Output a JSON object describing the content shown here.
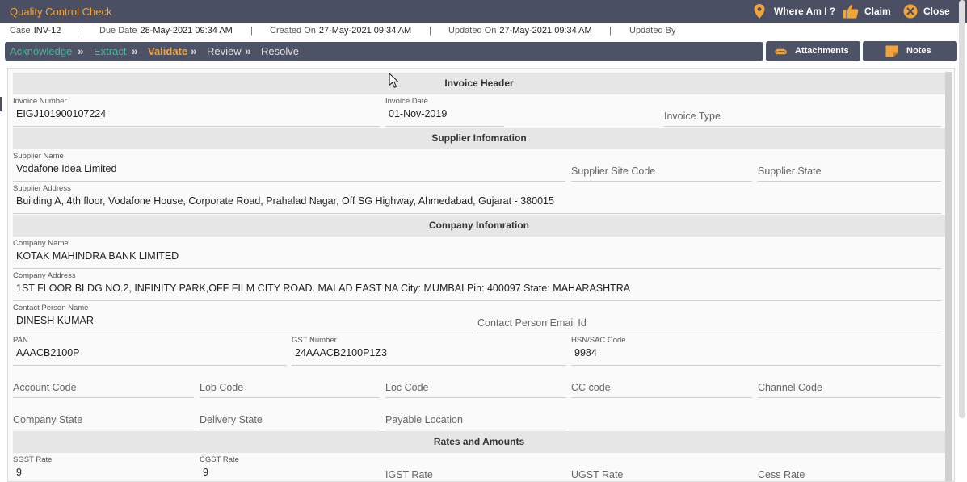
{
  "app": {
    "title": "Quality Control Check",
    "accent": "#f0a43a",
    "header_bg": "#4a4f63"
  },
  "actions": {
    "where": "Where Am I ?",
    "claim": "Claim",
    "close": "Close"
  },
  "meta": {
    "case_label": "Case",
    "case_value": "INV-12",
    "due_label": "Due Date",
    "due_value": "28-May-2021 09:34 AM",
    "created_label": "Created On",
    "created_value": "27-May-2021 09:34 AM",
    "updated_label": "Updated On",
    "updated_value": "27-May-2021 09:34 AM",
    "updatedby_label": "Updated By",
    "separator": "|"
  },
  "steps": {
    "acknowledge": "Acknowledge",
    "extract": "Extract",
    "validate": "Validate",
    "review": "Review",
    "resolve": "Resolve",
    "chevron": "»",
    "done_color": "#45b99c",
    "active_color": "#f0a43a",
    "pending_color": "#e0e0e0"
  },
  "buttons": {
    "attachments": "Attachments",
    "notes": "Notes"
  },
  "sections": {
    "invoice_header": "Invoice Header",
    "supplier": "Supplier Infomration",
    "company": "Company Infomration",
    "rates": "Rates and Amounts"
  },
  "fields": {
    "invoice_number": {
      "label": "Invoice Number",
      "value": "EIGJ101900107224"
    },
    "invoice_date": {
      "label": "Invoice Date",
      "value": "01-Nov-2019"
    },
    "invoice_type": {
      "placeholder": "Invoice Type"
    },
    "supplier_name": {
      "label": "Supplier Name",
      "value": "Vodafone Idea Limited"
    },
    "supplier_site_code": {
      "placeholder": "Supplier Site Code"
    },
    "supplier_state": {
      "placeholder": "Supplier State"
    },
    "supplier_address": {
      "label": "Supplier Address",
      "value": "Building A, 4th floor, Vodafone House, Corporate Road, Prahalad Nagar, Off SG Highway, Ahmedabad, Gujarat - 380015"
    },
    "company_name": {
      "label": "Company Name",
      "value": "KOTAK MAHINDRA BANK LIMITED"
    },
    "company_address": {
      "label": "Company Address",
      "value": "1ST FLOOR BLDG NO.2, INFINITY PARK,OFF FILM CITY ROAD. MALAD EAST NA City: MUMBAI Pin: 400097 State: MAHARASHTRA"
    },
    "contact_person_name": {
      "label": "Contact Person Name",
      "value": "DINESH KUMAR"
    },
    "contact_person_email": {
      "placeholder": "Contact Person Email Id"
    },
    "pan": {
      "label": "PAN",
      "value": "AAACB2100P"
    },
    "gst_number": {
      "label": "GST Number",
      "value": "24AAACB2100P1Z3"
    },
    "hsn_sac_code": {
      "label": "HSN/SAC Code",
      "value": "9984"
    },
    "account_code": {
      "placeholder": "Account Code"
    },
    "lob_code": {
      "placeholder": "Lob Code"
    },
    "loc_code": {
      "placeholder": "Loc Code"
    },
    "cc_code": {
      "placeholder": "CC code"
    },
    "channel_code": {
      "placeholder": "Channel Code"
    },
    "company_state": {
      "placeholder": "Company State"
    },
    "delivery_state": {
      "placeholder": "Delivery State"
    },
    "payable_location": {
      "placeholder": "Payable Location"
    },
    "sgst_rate": {
      "label": "SGST Rate",
      "value": "9"
    },
    "cgst_rate": {
      "label": "CGST Rate",
      "value": "9"
    },
    "igst_rate": {
      "placeholder": "IGST Rate"
    },
    "ugst_rate": {
      "placeholder": "UGST Rate"
    },
    "cess_rate": {
      "placeholder": "Cess Rate"
    }
  }
}
